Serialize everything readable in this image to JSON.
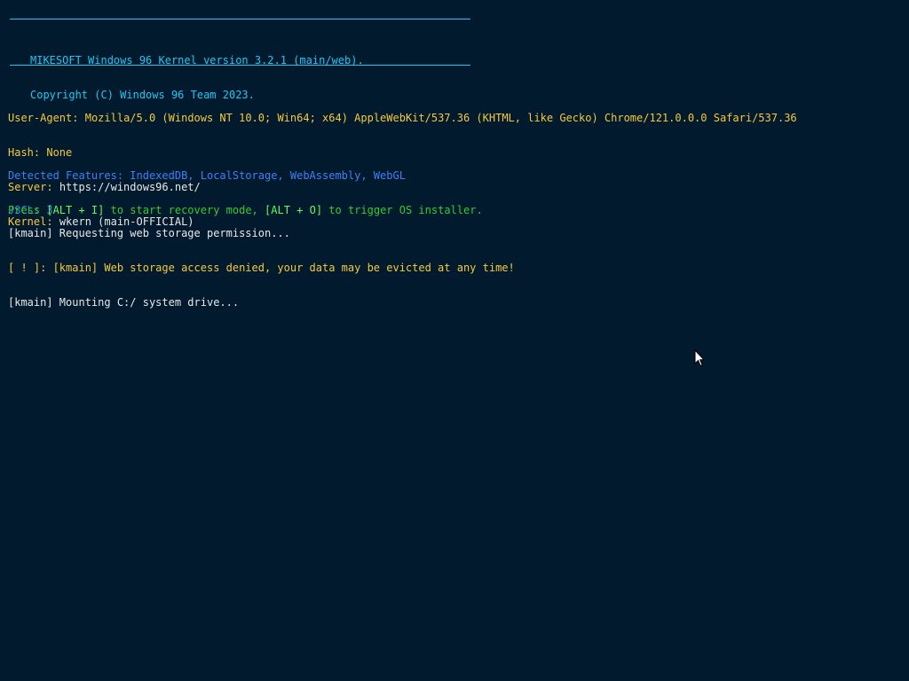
{
  "banner": {
    "line1": "MIKESOFT Windows 96 Kernel version 3.2.1 (main/web).",
    "line2": "Copyright (C) Windows 96 Team 2023."
  },
  "info": {
    "user_agent_label": "User-Agent:",
    "user_agent_value": "Mozilla/5.0 (Windows NT 10.0; Win64; x64) AppleWebKit/537.36 (KHTML, like Gecko) Chrome/121.0.0.0 Safari/537.36",
    "hash_label": "Hash:",
    "hash_value": "None",
    "server_label": "Server:",
    "server_value": "https://windows96.net/",
    "kernel_label": "Kernel:",
    "kernel_value": "wkern (main-OFFICIAL)"
  },
  "features": {
    "detected": "Detected Features: IndexedDB, LocalStorage, WebAssembly, WebGL",
    "jscl": "JSCL: 3"
  },
  "recovery": {
    "press": "Press ",
    "key1": "[ALT + I]",
    "mid": " to start recovery mode, ",
    "key2": "[ALT + O]",
    "end": " to trigger OS installer."
  },
  "log": {
    "line1": "[kmain] Requesting web storage permission...",
    "line2": "[ ! ]: [kmain] Web storage access denied, your data may be evicted at any time!",
    "line3": "[kmain] Mounting C:/ system drive..."
  },
  "icons": {
    "cursor": "mouse-pointer-icon"
  }
}
